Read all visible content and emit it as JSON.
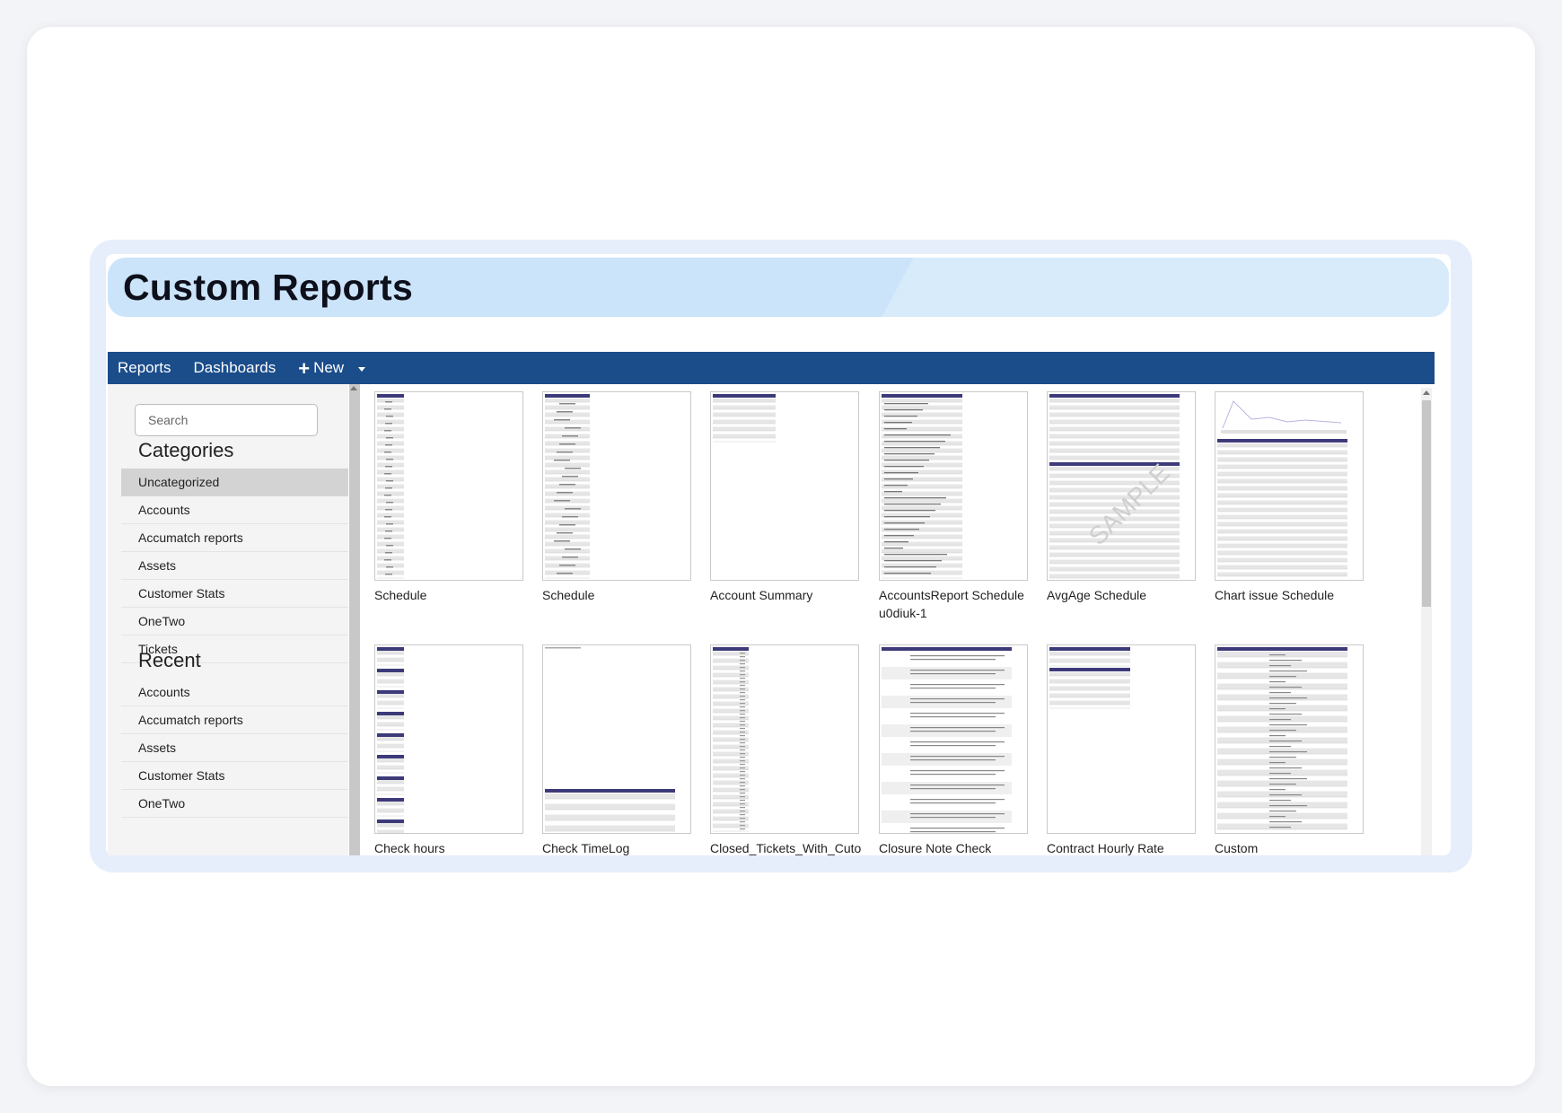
{
  "page": {
    "title": "Custom Reports"
  },
  "nav": {
    "reports": "Reports",
    "dashboards": "Dashboards",
    "new_label": "New",
    "new_icon": "plus-icon",
    "dropdown_icon": "caret-down-icon"
  },
  "search": {
    "placeholder": "Search",
    "value": ""
  },
  "sidebar": {
    "categories_heading": "Categories",
    "categories": [
      {
        "label": "Uncategorized",
        "active": true
      },
      {
        "label": "Accounts"
      },
      {
        "label": "Accumatch reports"
      },
      {
        "label": "Assets"
      },
      {
        "label": "Customer Stats"
      },
      {
        "label": "OneTwo"
      },
      {
        "label": "Tickets"
      }
    ],
    "recent_heading": "Recent",
    "recent": [
      {
        "label": "Accounts"
      },
      {
        "label": "Accumatch reports"
      },
      {
        "label": "Assets"
      },
      {
        "label": "Customer Stats"
      },
      {
        "label": "OneTwo"
      }
    ]
  },
  "reports": [
    {
      "name": "Schedule",
      "style": "narrow"
    },
    {
      "name": "Schedule",
      "style": "narrow2"
    },
    {
      "name": "Account Summary",
      "style": "top"
    },
    {
      "name": [
        "AccountsReport Schedule",
        "u0diuk-1"
      ],
      "style": "list"
    },
    {
      "name": "AvgAge Schedule",
      "style": "table"
    },
    {
      "name": "Chart issue Schedule",
      "style": "chart"
    },
    {
      "name": "Check hours",
      "style": "blocks"
    },
    {
      "name": "Check TimeLog",
      "style": "bottom"
    },
    {
      "name": "Closed_Tickets_With_Cuto",
      "style": "columns"
    },
    {
      "name": "Closure Note Check",
      "style": "notes"
    },
    {
      "name": "Contract Hourly Rate",
      "style": "smalltable"
    },
    {
      "name": "Custom",
      "style": "dense"
    }
  ],
  "colors": {
    "nav": "#1b4d8b",
    "header": "#cbe4fa",
    "frame": "#e6eefb",
    "accent": "#3d3a7a"
  }
}
